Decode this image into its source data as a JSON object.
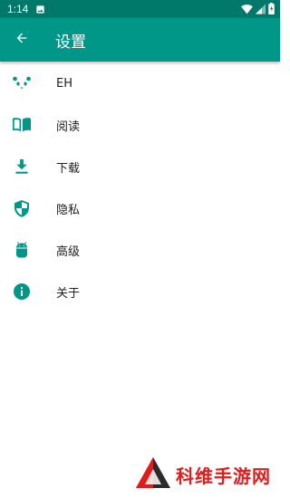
{
  "status_bar": {
    "time": "1:14",
    "icons": [
      "image-icon",
      "wifi-icon",
      "signal-icon",
      "battery-icon"
    ]
  },
  "app_bar": {
    "title": "设置",
    "back_icon": "arrow-back-icon"
  },
  "menu": {
    "items": [
      {
        "label": "EH",
        "icon": "panda-icon"
      },
      {
        "label": "阅读",
        "icon": "book-icon"
      },
      {
        "label": "下载",
        "icon": "download-icon"
      },
      {
        "label": "隐私",
        "icon": "shield-icon"
      },
      {
        "label": "高级",
        "icon": "android-icon"
      },
      {
        "label": "关于",
        "icon": "info-icon"
      }
    ]
  },
  "watermark": {
    "text": "科维手游网"
  },
  "colors": {
    "status_bar": "#00796b",
    "app_bar": "#009688",
    "icon_tint": "#009688",
    "text": "#212121",
    "watermark": "#e31b1b"
  }
}
